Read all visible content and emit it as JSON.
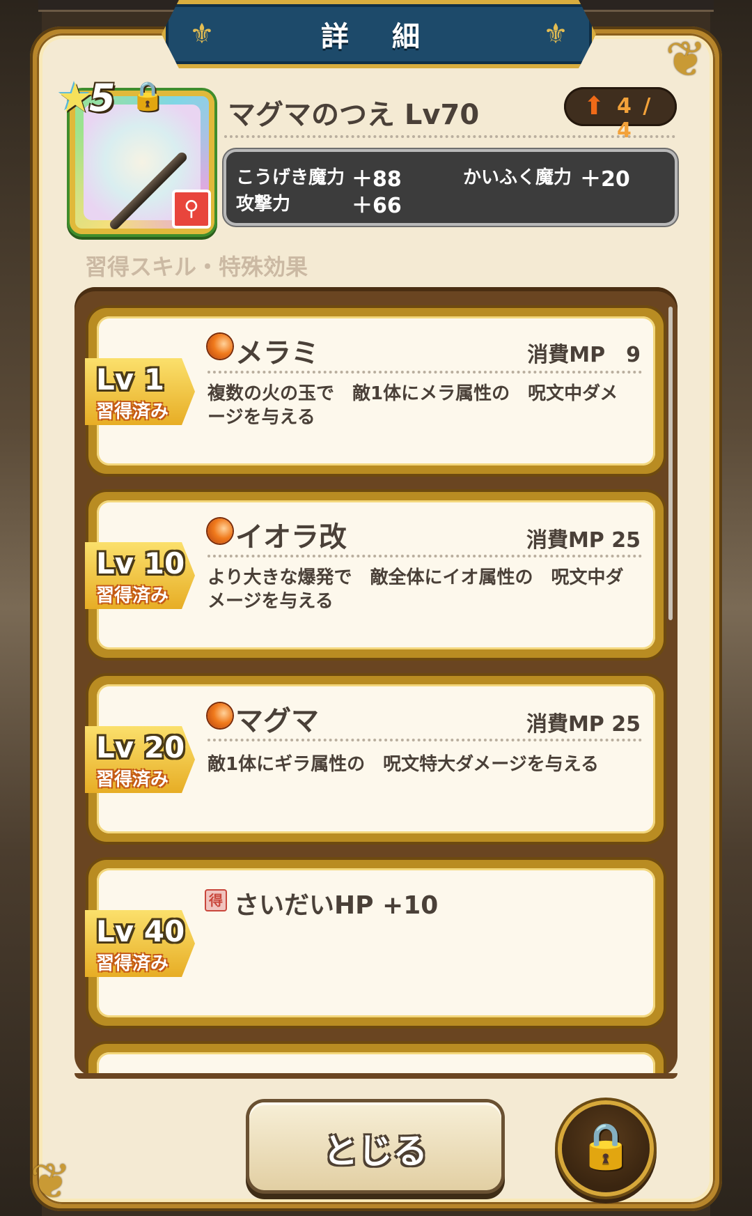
{
  "title": "詳 細",
  "item": {
    "rarity_stars": "5",
    "name": "マグマのつえ Lv70",
    "upgrade": "4 / 4",
    "icon": "staff-icon"
  },
  "stats": [
    {
      "label": "こうげき魔力",
      "value": "＋88"
    },
    {
      "label": "かいふく魔力",
      "value": "＋20"
    },
    {
      "label": "攻撃力",
      "value": "＋66"
    }
  ],
  "section_label": "習得スキル・特殊効果",
  "skills": [
    {
      "level": "Lv 1",
      "status": "習得済み",
      "name": "メラミ",
      "mp": "消費MP　9",
      "desc": "複数の火の玉で　敵1体にメラ属性の　呪文中ダメージを与える"
    },
    {
      "level": "Lv 10",
      "status": "習得済み",
      "name": "イオラ改",
      "mp": "消費MP 25",
      "desc": "より大きな爆発で　敵全体にイオ属性の　呪文中ダメージを与える"
    },
    {
      "level": "Lv 20",
      "status": "習得済み",
      "name": "マグマ",
      "mp": "消費MP 25",
      "desc": "敵1体にギラ属性の　呪文特大ダメージを与える"
    },
    {
      "level": "Lv 40",
      "status": "習得済み",
      "name": "さいだいHP +10",
      "tag": "得"
    }
  ],
  "close_label": "とじる",
  "colors": {
    "banner": "#1d4a6a",
    "accent_gold": "#d8ad3e",
    "panel": "#6a4521"
  }
}
